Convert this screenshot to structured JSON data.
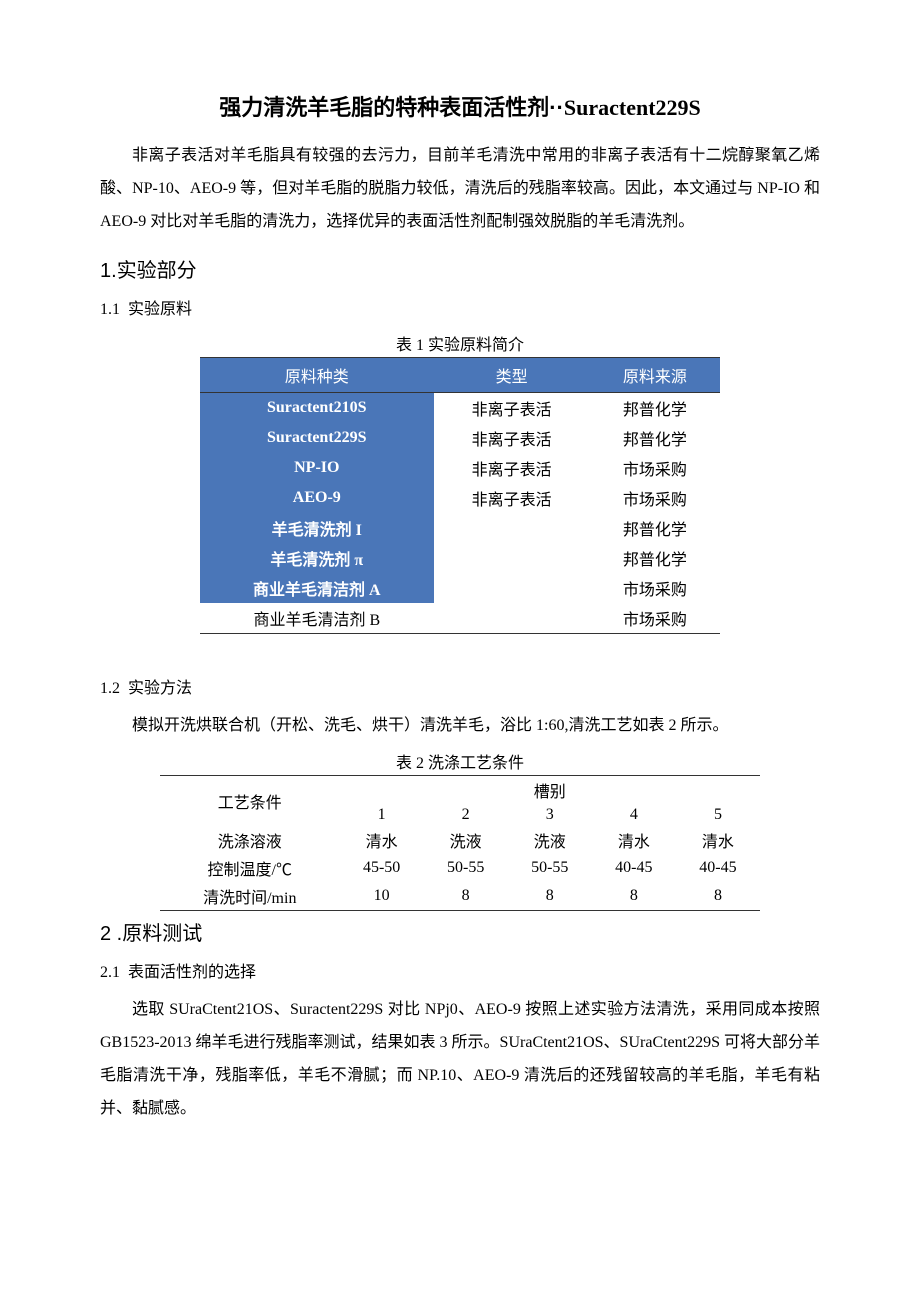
{
  "title_cn": "强力清洗羊毛脂的特种表面活性剂··",
  "title_en": "Suractent229S",
  "intro": "非离子表活对羊毛脂具有较强的去污力，目前羊毛清洗中常用的非离子表活有十二烷醇聚氧乙烯酸、NP-10、AEO-9 等，但对羊毛脂的脱脂力较低，清洗后的残脂率较高。因此，本文通过与 NP-IO 和 AEO-9 对比对羊毛脂的清洗力，选择优异的表面活性剂配制强效脱脂的羊毛清洗剂。",
  "s1": {
    "num": "1",
    "dot": ".",
    "title": "实验部分"
  },
  "s11": {
    "num": "1.1",
    "title": "实验原料"
  },
  "t1_caption": "表 1 实验原料简介",
  "t1": {
    "headers": [
      "原料种类",
      "类型",
      "原料来源"
    ],
    "rows": [
      {
        "name": "Suractent210S",
        "type": "非离子表活",
        "source": "邦普化学",
        "hl": true
      },
      {
        "name": "Suractent229S",
        "type": "非离子表活",
        "source": "邦普化学",
        "hl": true
      },
      {
        "name": "NP-IO",
        "type": "非离子表活",
        "source": "市场采购",
        "hl": true
      },
      {
        "name": "AEO-9",
        "type": "非离子表活",
        "source": "市场采购",
        "hl": true
      },
      {
        "name": "羊毛清洗剂 I",
        "type": "",
        "source": "邦普化学",
        "hl": true
      },
      {
        "name": "羊毛清洗剂 π",
        "type": "",
        "source": "邦普化学",
        "hl": true
      },
      {
        "name": "商业羊毛清洁剂 A",
        "type": "",
        "source": "市场采购",
        "hl": true
      },
      {
        "name": "商业羊毛清洁剂 B",
        "type": "",
        "source": "市场采购",
        "hl": false
      }
    ]
  },
  "s12": {
    "num": "1.2",
    "title": "实验方法"
  },
  "s12_body": "模拟开洗烘联合机（开松、洗毛、烘干）清洗羊毛，浴比 1:60,清洗工艺如表 2 所示。",
  "t2_caption": "表 2 洗涤工艺条件",
  "t2": {
    "corner": "工艺条件",
    "super": "槽别",
    "cols": [
      "1",
      "2",
      "3",
      "4",
      "5"
    ],
    "rows": [
      {
        "label": "洗涤溶液",
        "vals": [
          "清水",
          "洗液",
          "洗液",
          "清水",
          "清水"
        ]
      },
      {
        "label": "控制温度/℃",
        "vals": [
          "45-50",
          "50-55",
          "50-55",
          "40-45",
          "40-45"
        ]
      },
      {
        "label": "清洗时间/min",
        "vals": [
          "10",
          "8",
          "8",
          "8",
          "8"
        ]
      }
    ]
  },
  "s2": {
    "num": "2",
    "dot": " .",
    "title": "原料测试"
  },
  "s21": {
    "num": "2.1",
    "title": "表面活性剂的选择"
  },
  "s21_body": "选取 SUraCtent21OS、Suractent229S 对比 NPj0、AEO-9 按照上述实验方法清洗，采用同成本按照 GB1523-2013 绵羊毛进行残脂率测试，结果如表 3 所示。SUraCtent21OS、SUraCtent229S 可将大部分羊毛脂清洗干净，残脂率低，羊毛不滑腻；而 NP.10、AEO-9 清洗后的还残留较高的羊毛脂，羊毛有粘并、黏腻感。"
}
